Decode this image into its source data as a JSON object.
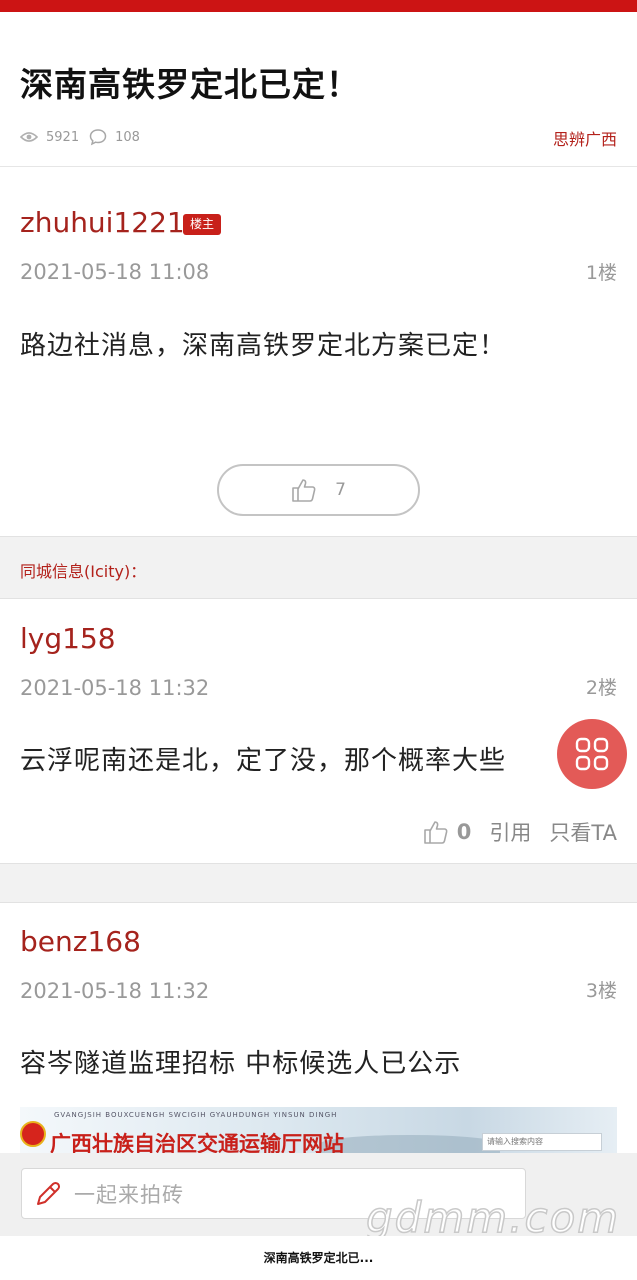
{
  "thread": {
    "title": "深南高铁罗定北已定！",
    "views": "5921",
    "replies": "108",
    "forum": "思辨广西"
  },
  "posts": [
    {
      "author": "zhuhui1221",
      "badge": "楼主",
      "time": "2021-05-18 11:08",
      "floor": "1楼",
      "content": "路边社消息，深南高铁罗定北方案已定！",
      "likes": "7"
    },
    {
      "author": "lyg158",
      "time": "2021-05-18 11:32",
      "floor": "2楼",
      "content": "云浮呢南还是北，定了没，那个概率大些",
      "likes": "0",
      "quote_label": "引用",
      "only_label": "只看TA"
    },
    {
      "author": "benz168",
      "time": "2021-05-18 11:32",
      "floor": "3楼",
      "content": "容岑隧道监理招标 中标候选人已公示"
    }
  ],
  "section_label": "同城信息(Icity)：",
  "banner": {
    "tagline": "GVANGJSIH BOUXCUENGH SWCIGIH GYAUHDUNGH YINSUN DINGH",
    "site": "广西壮族自治区交通运输厅网站",
    "search_placeholder": "请输入搜索内容"
  },
  "reply_bar": {
    "placeholder": "一起来拍砖"
  },
  "watermark": "gdmm.com",
  "page_caption": "深南高铁罗定北已...",
  "colors": {
    "accent": "#c8201a",
    "author": "#a5231d",
    "fab": "#e35a57"
  }
}
